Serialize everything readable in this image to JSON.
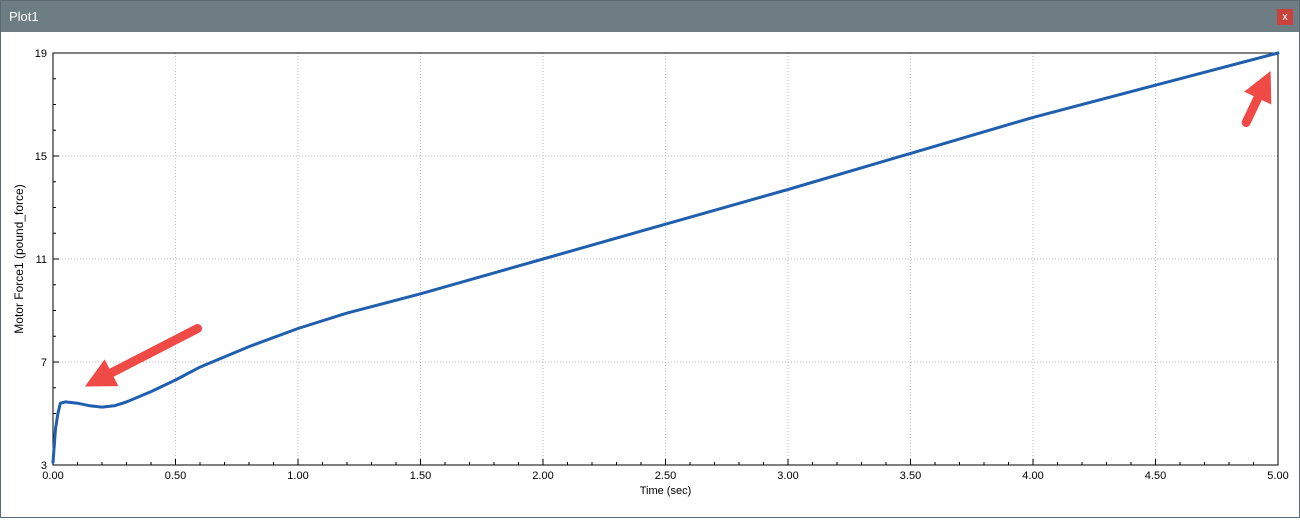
{
  "window": {
    "title": "Plot1",
    "close_label": "x"
  },
  "colors": {
    "titlebar": "#6e7d84",
    "close_button": "#c9433d",
    "series_line": "#1f5fae",
    "arrow": "#f04a47",
    "grid": "#bdbdbd"
  },
  "chart_data": {
    "type": "line",
    "xlabel": "Time (sec)",
    "ylabel": "Motor Force1 (pound_force)",
    "xlim": [
      0,
      5
    ],
    "ylim": [
      3,
      19
    ],
    "x_ticks": [
      "0.00",
      "0.50",
      "1.00",
      "1.50",
      "2.00",
      "2.50",
      "3.00",
      "3.50",
      "4.00",
      "4.50",
      "5.00"
    ],
    "y_ticks": [
      "3",
      "7",
      "11",
      "15",
      "19"
    ],
    "grid": true,
    "series": [
      {
        "x": [
          0,
          0.01,
          0.02,
          0.03,
          0.05,
          0.1,
          0.15,
          0.2,
          0.25,
          0.3,
          0.4,
          0.5,
          0.6,
          0.8,
          1.0,
          1.2,
          1.5,
          2.0,
          2.5,
          3.0,
          3.5,
          4.0,
          4.5,
          5.0
        ],
        "y": [
          3.1,
          4.4,
          5.0,
          5.4,
          5.45,
          5.4,
          5.3,
          5.25,
          5.3,
          5.45,
          5.85,
          6.3,
          6.8,
          7.6,
          8.3,
          8.9,
          9.65,
          11.0,
          12.35,
          13.7,
          15.1,
          16.5,
          17.75,
          19.0
        ]
      }
    ],
    "annotations": [
      {
        "type": "arrow",
        "tail": [
          0.59,
          8.3
        ],
        "head": [
          0.13,
          6.05
        ]
      },
      {
        "type": "arrow",
        "tail": [
          4.87,
          16.3
        ],
        "head": [
          4.97,
          18.3
        ]
      }
    ]
  }
}
